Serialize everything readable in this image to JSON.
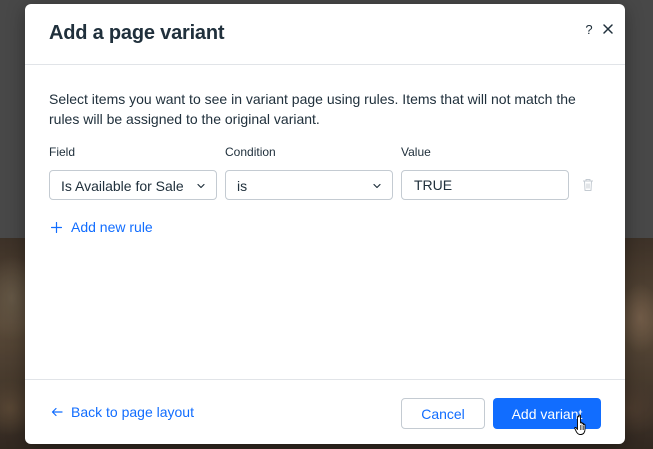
{
  "dialog": {
    "title": "Add a page variant",
    "help_label": "?",
    "description": "Select items you want to see in variant page using rules. Items that will not match the rules will be assigned to the original variant."
  },
  "rule_columns": {
    "field": "Field",
    "condition": "Condition",
    "value": "Value"
  },
  "rule": {
    "field_selected": "Is Available for Sale",
    "condition_selected": "is",
    "value": "TRUE"
  },
  "add_rule_label": "Add new rule",
  "footer": {
    "back_label": "Back to page layout",
    "cancel_label": "Cancel",
    "submit_label": "Add variant"
  },
  "colors": {
    "accent": "#116dff",
    "text": "#20303c",
    "border": "#c4cbd2"
  },
  "icons": [
    "help-icon",
    "close-icon",
    "chevron-down-icon",
    "trash-icon",
    "plus-icon",
    "arrow-left-icon",
    "pointer-cursor-icon"
  ]
}
